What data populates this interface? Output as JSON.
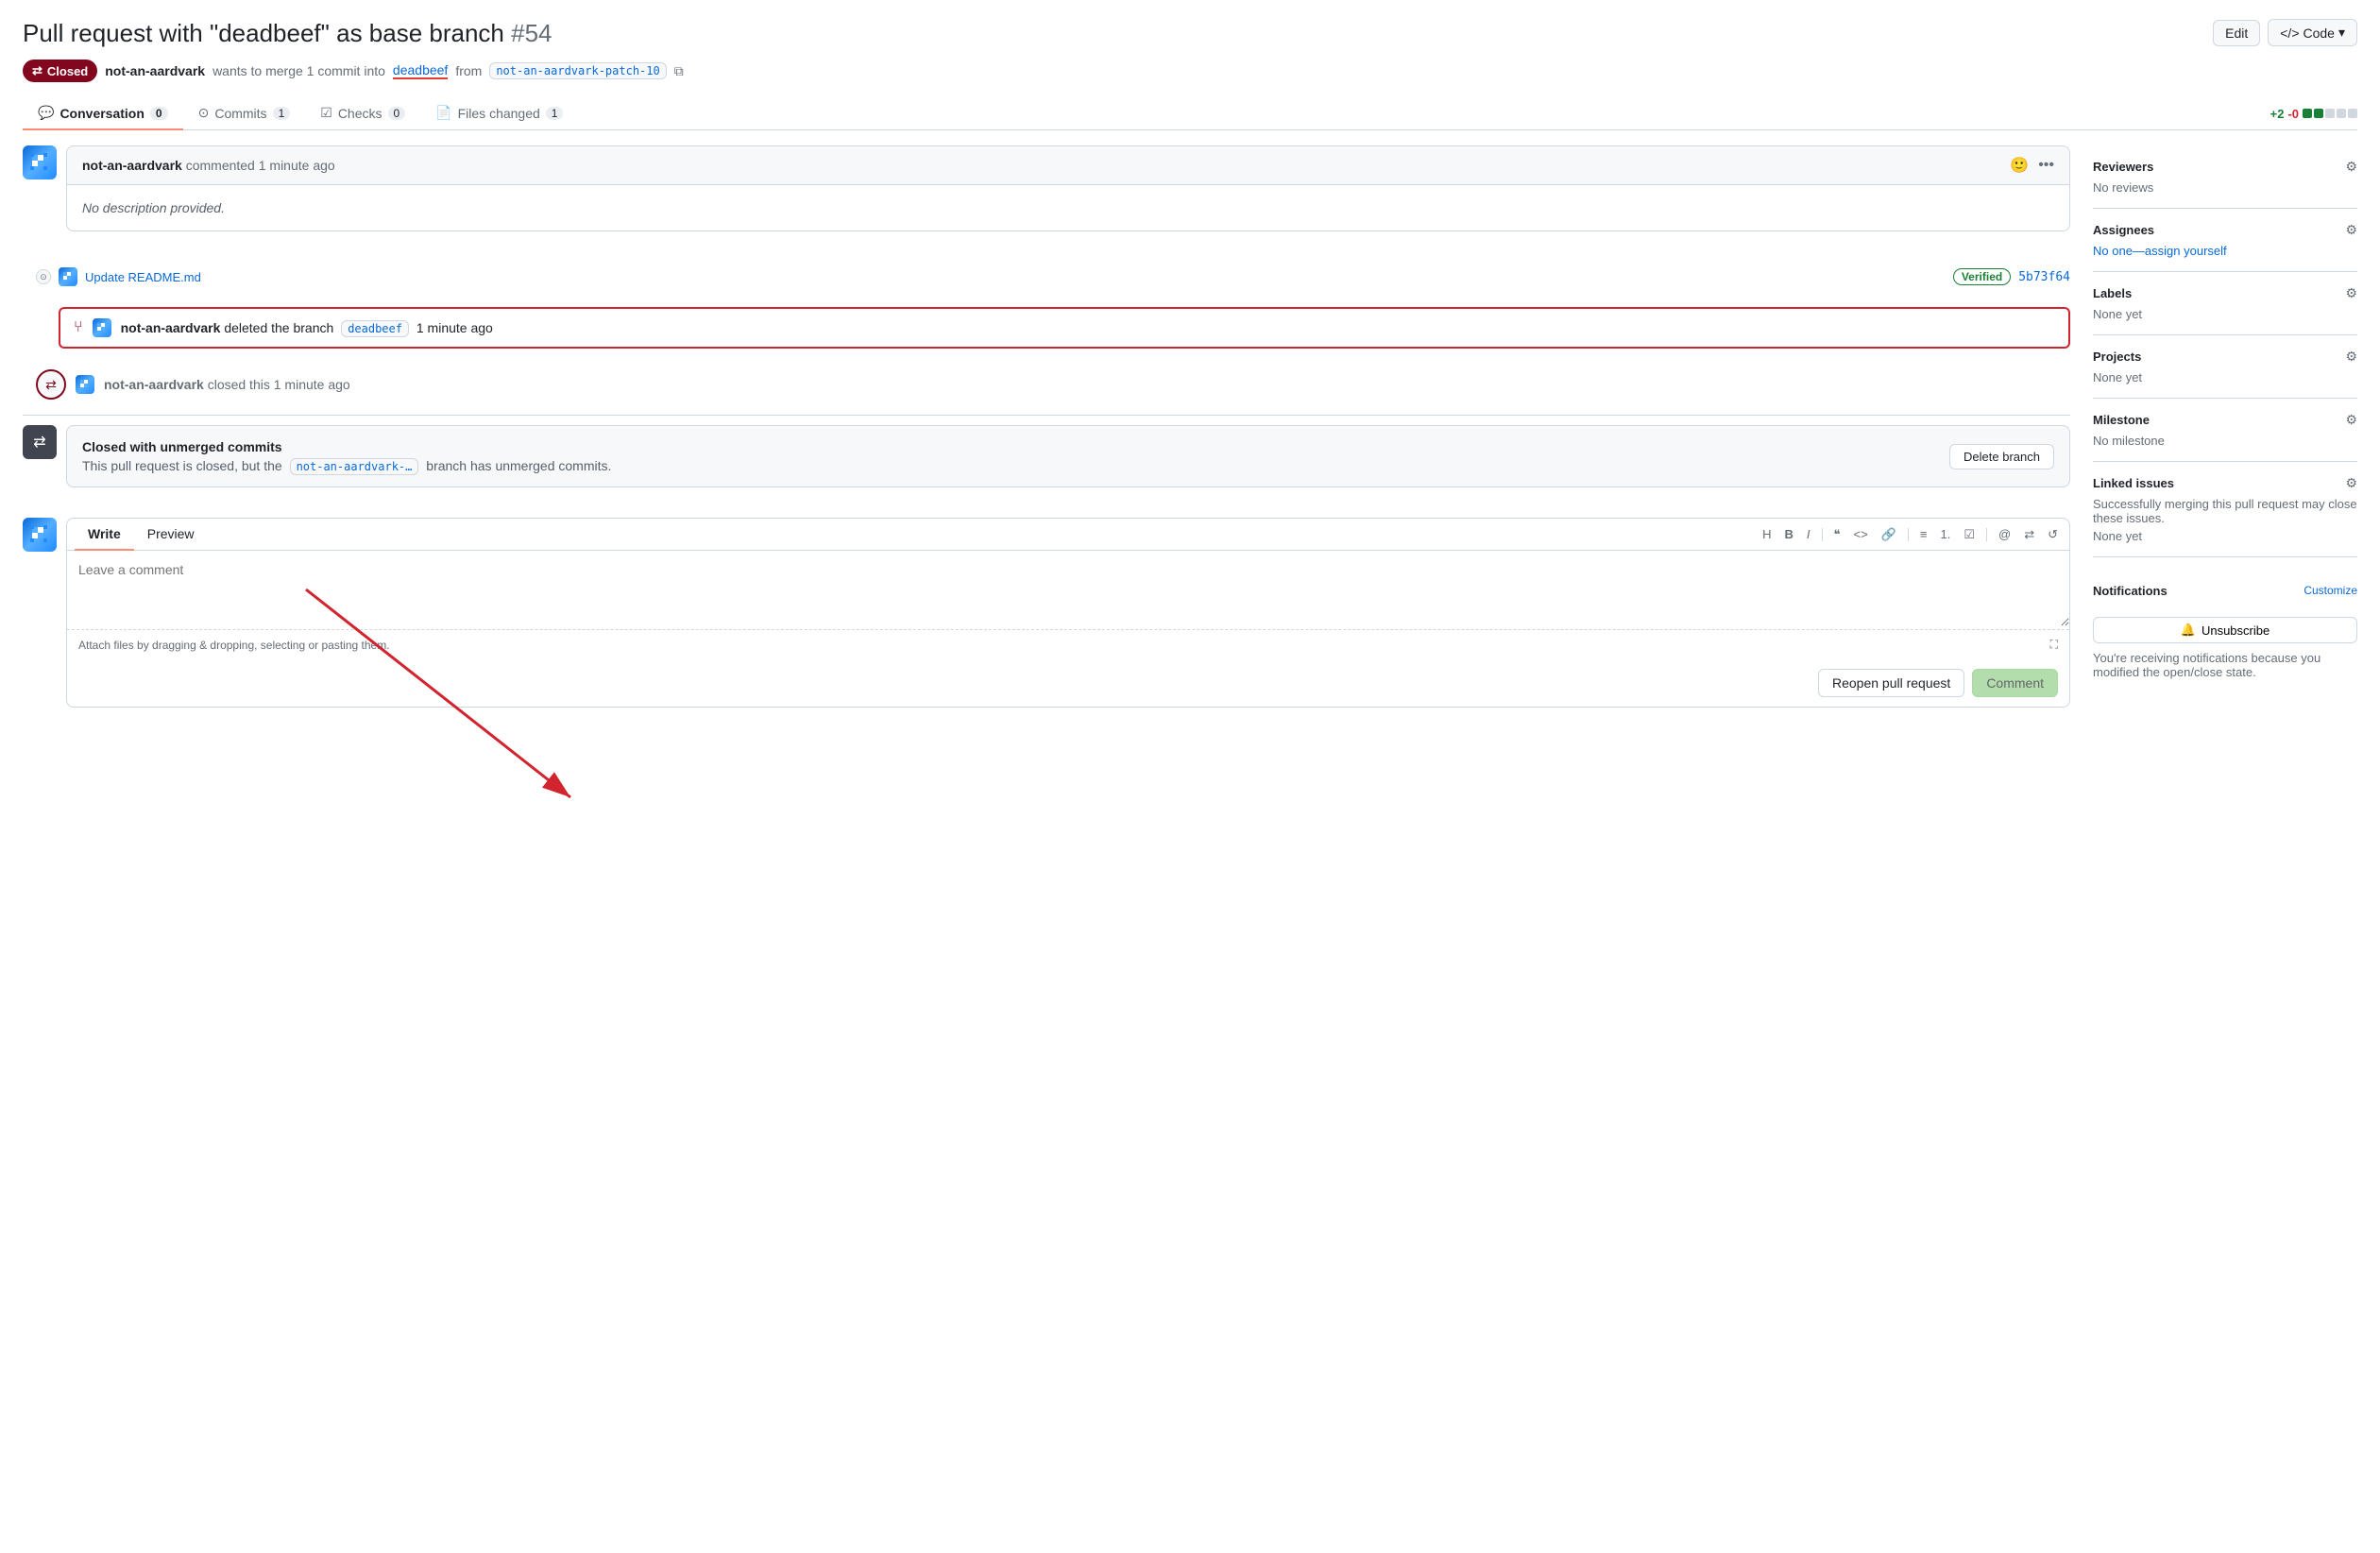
{
  "page": {
    "title": "Pull request with \"deadbeef\" as base branch",
    "pr_number": "#54",
    "status": "Closed",
    "author": "not-an-aardvark",
    "merge_info": "wants to merge 1 commit into",
    "base_branch": "deadbeef",
    "from_text": "from",
    "head_branch": "not-an-aardvark-patch-10"
  },
  "header_buttons": {
    "edit_label": "Edit",
    "code_label": "Code"
  },
  "tabs": {
    "conversation_label": "Conversation",
    "conversation_count": "0",
    "commits_label": "Commits",
    "commits_count": "1",
    "checks_label": "Checks",
    "checks_count": "0",
    "files_changed_label": "Files changed",
    "files_changed_count": "1"
  },
  "diff_stat": {
    "additions": "+2",
    "deletions": "-0"
  },
  "comment": {
    "author": "not-an-aardvark",
    "time": "commented 1 minute ago",
    "body": "No description provided."
  },
  "commit_line": {
    "label": "Update README.md",
    "verified": "Verified",
    "hash": "5b73f64"
  },
  "deleted_branch": {
    "author": "not-an-aardvark",
    "action": "deleted the branch",
    "branch": "deadbeef",
    "time": "1 minute ago"
  },
  "closed_event": {
    "author": "not-an-aardvark",
    "action": "closed this",
    "time": "1 minute ago"
  },
  "unmerged_notice": {
    "title": "Closed with unmerged commits",
    "body": "This pull request is closed, but the",
    "branch": "not-an-aardvark-…",
    "body2": "branch has unmerged commits.",
    "button": "Delete branch"
  },
  "editor": {
    "write_tab": "Write",
    "preview_tab": "Preview",
    "placeholder": "Leave a comment",
    "footer_text": "Attach files by dragging & dropping, selecting or pasting them.",
    "reopen_button": "Reopen pull request",
    "comment_button": "Comment"
  },
  "sidebar": {
    "reviewers_title": "Reviewers",
    "reviewers_value": "No reviews",
    "assignees_title": "Assignees",
    "assignees_value": "No one—assign yourself",
    "labels_title": "Labels",
    "labels_value": "None yet",
    "projects_title": "Projects",
    "projects_value": "None yet",
    "milestone_title": "Milestone",
    "milestone_value": "No milestone",
    "linked_issues_title": "Linked issues",
    "linked_issues_value": "Successfully merging this pull request may close these issues.",
    "linked_issues_value2": "None yet",
    "notifications_title": "Notifications",
    "notifications_customize": "Customize",
    "unsubscribe_button": "Unsubscribe",
    "notifications_note": "You're receiving notifications because you modified the open/close state."
  }
}
